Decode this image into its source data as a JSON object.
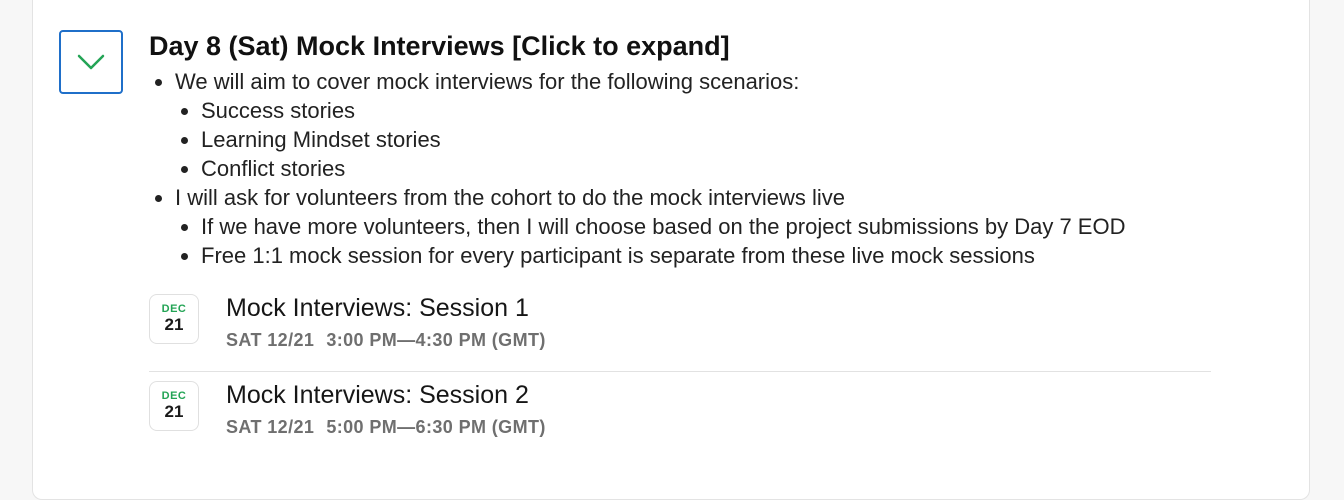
{
  "section": {
    "title": "Day 8 (Sat) Mock Interviews [Click to expand]",
    "toggle_icon": "chevron-down-icon",
    "accent_color": "#1f6fc9",
    "chevron_color": "#23a455"
  },
  "bullets": [
    {
      "text": "We will aim to cover mock interviews for the following scenarios:",
      "children": [
        "Success stories",
        "Learning Mindset stories",
        "Conflict stories"
      ]
    },
    {
      "text": "I will ask for volunteers from the cohort to do the mock interviews live",
      "children": [
        "If we have more volunteers, then I will choose based on the project submissions by Day 7 EOD",
        "Free 1:1 mock session for every participant is separate from these live mock sessions"
      ]
    }
  ],
  "events": [
    {
      "month": "DEC",
      "day": "21",
      "title": "Mock Interviews: Session 1",
      "date": "SAT 12/21",
      "time": "3:00 PM—4:30 PM (GMT)"
    },
    {
      "month": "DEC",
      "day": "21",
      "title": "Mock Interviews: Session 2",
      "date": "SAT 12/21",
      "time": "5:00 PM—6:30 PM (GMT)"
    }
  ]
}
